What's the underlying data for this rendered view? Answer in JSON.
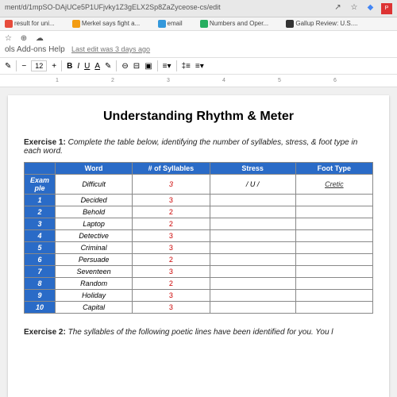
{
  "browser": {
    "url": "ment/d/1mpSO-DAjUCe5P1UFjvky1Z3gELX2Sp8ZaZyceose-cs/edit",
    "bookmarks": [
      {
        "label": "result for uni...",
        "color": "#e74c3c"
      },
      {
        "label": "Merkel says fight a...",
        "color": "#f39c12"
      },
      {
        "label": "email",
        "color": "#3498db"
      },
      {
        "label": "Numbers and Oper...",
        "color": "#27ae60"
      },
      {
        "label": "Gallup Review: U.S....",
        "color": "#333"
      }
    ]
  },
  "doc": {
    "menu": {
      "tools": "ols",
      "addons": "Add-ons",
      "help": "Help"
    },
    "last_edit": "Last edit was 3 days ago",
    "font_size": "12",
    "title": "Understanding Rhythm & Meter"
  },
  "ex1": {
    "label": "Exercise 1:",
    "text": " Complete the table below, identifying the number of syllables, stress, & foot type in each word.",
    "headers": {
      "word": "Word",
      "syl": "# of Syllables",
      "stress": "Stress",
      "foot": "Foot Type"
    },
    "example_label": "Exam ple",
    "example": {
      "word": "Difficult",
      "syl": "3",
      "stress": "/ U /",
      "foot": "Cretic"
    },
    "rows": [
      {
        "n": "1",
        "word": "Decided",
        "syl": "3"
      },
      {
        "n": "2",
        "word": "Behold",
        "syl": "2"
      },
      {
        "n": "3",
        "word": "Laptop",
        "syl": "2"
      },
      {
        "n": "4",
        "word": "Detective",
        "syl": "3"
      },
      {
        "n": "5",
        "word": "Criminal",
        "syl": "3"
      },
      {
        "n": "6",
        "word": "Persuade",
        "syl": "2"
      },
      {
        "n": "7",
        "word": "Seventeen",
        "syl": "3"
      },
      {
        "n": "8",
        "word": "Random",
        "syl": "2"
      },
      {
        "n": "9",
        "word": "Holiday",
        "syl": "3"
      },
      {
        "n": "10",
        "word": "Capital",
        "syl": "3"
      }
    ]
  },
  "ex2": {
    "label": "Exercise 2:",
    "text": " The syllables of the following poetic lines have been identified for you. You l"
  },
  "chart_data": {
    "type": "table",
    "title": "Understanding Rhythm & Meter - Exercise 1",
    "columns": [
      "#",
      "Word",
      "# of Syllables",
      "Stress",
      "Foot Type"
    ],
    "rows": [
      [
        "Example",
        "Difficult",
        3,
        "/ U /",
        "Cretic"
      ],
      [
        1,
        "Decided",
        3,
        "",
        ""
      ],
      [
        2,
        "Behold",
        2,
        "",
        ""
      ],
      [
        3,
        "Laptop",
        2,
        "",
        ""
      ],
      [
        4,
        "Detective",
        3,
        "",
        ""
      ],
      [
        5,
        "Criminal",
        3,
        "",
        ""
      ],
      [
        6,
        "Persuade",
        2,
        "",
        ""
      ],
      [
        7,
        "Seventeen",
        3,
        "",
        ""
      ],
      [
        8,
        "Random",
        2,
        "",
        ""
      ],
      [
        9,
        "Holiday",
        3,
        "",
        ""
      ],
      [
        10,
        "Capital",
        3,
        "",
        ""
      ]
    ]
  }
}
